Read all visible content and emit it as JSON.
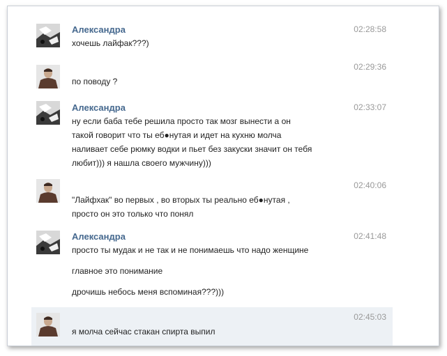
{
  "messages": [
    {
      "author": "Александра",
      "time": "02:28:58",
      "avatar": "avatar-alexandra-icon",
      "lines": [
        "хочешь лайфак???)"
      ]
    },
    {
      "author": "",
      "time": "02:29:36",
      "avatar": "avatar-man-icon",
      "lines": [
        "по поводу ?"
      ]
    },
    {
      "author": "Александра",
      "time": "02:33:07",
      "avatar": "avatar-alexandra-icon",
      "lines": [
        "ну если баба тебе решила просто так мозг вынести а он",
        "такой говорит что ты еб●нутая и идет на кухню молча",
        "наливает себе рюмку водки и пьет без закуски значит он тебя",
        "любит))) я нашла своего мужчину)))"
      ]
    },
    {
      "author": "",
      "time": "02:40:06",
      "avatar": "avatar-man-icon",
      "lines": [
        "\"Лайфхак\" во первых , во вторых ты реально еб●нутая ,",
        "просто он это только что понял"
      ]
    },
    {
      "author": "Александра",
      "time": "02:41:48",
      "avatar": "avatar-alexandra-icon",
      "lines": [
        "просто ты мудак и не так и не понимаешь что надо женщине",
        "главное это понимание",
        "дрочишь небось меня вспоминая???)))"
      ]
    },
    {
      "author": "",
      "time": "02:45:03",
      "avatar": "avatar-man-icon",
      "lines": [
        "я молча сейчас стакан спирта выпил"
      ]
    }
  ],
  "colors": {
    "author": "#45688e",
    "time": "#999999",
    "text": "#222222",
    "highlight": "#edf1f5"
  }
}
